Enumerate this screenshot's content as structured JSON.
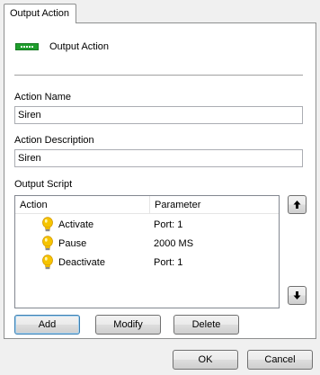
{
  "tab": {
    "label": "Output Action"
  },
  "header": {
    "icon": "green-output-led-icon",
    "title": "Output Action"
  },
  "form": {
    "action_name_label": "Action Name",
    "action_name_value": "Siren",
    "action_description_label": "Action Description",
    "action_description_value": "Siren",
    "output_script_label": "Output Script"
  },
  "script_list": {
    "columns": [
      "Action",
      "Parameter"
    ],
    "rows": [
      {
        "icon": "lightbulb-icon",
        "action": "Activate",
        "parameter": "Port: 1"
      },
      {
        "icon": "lightbulb-icon",
        "action": "Pause",
        "parameter": "2000 MS"
      },
      {
        "icon": "lightbulb-icon",
        "action": "Deactivate",
        "parameter": "Port: 1"
      }
    ]
  },
  "list_buttons": {
    "add": "Add",
    "modify": "Modify",
    "delete": "Delete"
  },
  "move_buttons": {
    "up_icon": "arrow-up-icon",
    "down_icon": "arrow-down-icon"
  },
  "dialog_buttons": {
    "ok": "OK",
    "cancel": "Cancel"
  },
  "colors": {
    "accent_green": "#1e9e2c",
    "bulb_yellow": "#f6c400"
  }
}
